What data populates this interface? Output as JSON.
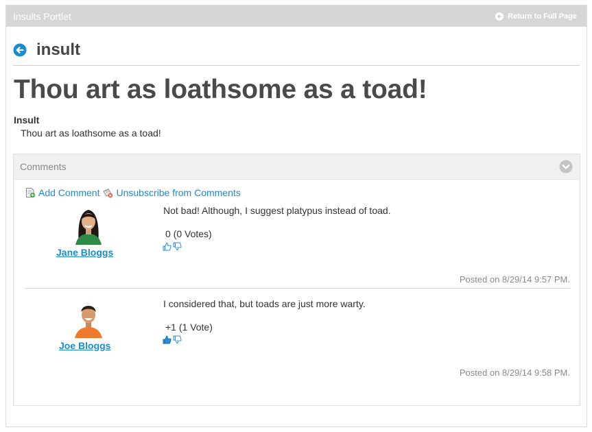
{
  "portlet": {
    "title": "Insults Portlet",
    "return_link": "Return to Full Page"
  },
  "back": {
    "title": "insult"
  },
  "entry": {
    "title": "Thou art as loathsome as a toad!",
    "field_label": "Insult",
    "field_value": "Thou art as loathsome as a toad!"
  },
  "comments": {
    "title": "Comments",
    "add_comment": "Add Comment",
    "unsubscribe": "Unsubscribe from Comments",
    "items": [
      {
        "user": "Jane Bloggs",
        "body": "Not bad! Although, I suggest platypus instead of toad.",
        "score": "0 (0 Votes)",
        "posted": "Posted on 8/29/14 9:57 PM."
      },
      {
        "user": "Joe Bloggs",
        "body": "I considered that, but toads are just more warty.",
        "score": "+1 (1 Vote)",
        "posted": "Posted on 8/29/14 9:58 PM."
      }
    ]
  },
  "colors": {
    "link": "#1a8ccb",
    "header_bg": "#d6d6d6",
    "muted": "#8a8a8a"
  },
  "icons": {
    "return": "arrow-left-circle-icon",
    "back": "arrow-left-circle-icon",
    "collapse": "chevron-down-circle-icon",
    "add_comment": "add-comment-icon",
    "unsubscribe": "unsubscribe-icon",
    "thumbs_up": "thumbs-up-icon",
    "thumbs_down": "thumbs-down-icon"
  }
}
